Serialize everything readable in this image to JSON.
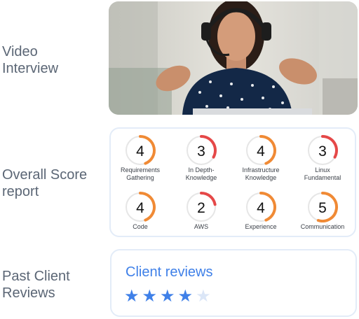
{
  "sections": {
    "video": {
      "line1": "Video",
      "line2": "Interview"
    },
    "score": {
      "line1": "Overall Score",
      "line2": "report"
    },
    "reviews": {
      "line1": "Past Client",
      "line2": "Reviews"
    }
  },
  "scores": [
    {
      "value": "4",
      "max": 5,
      "label1": "Requirements",
      "label2": "Gathering",
      "color": "#f08a35"
    },
    {
      "value": "3",
      "max": 5,
      "label1": "In Depth-",
      "label2": "Knowledge",
      "color": "#e54848"
    },
    {
      "value": "4",
      "max": 5,
      "label1": "Infrastructure",
      "label2": "Knowledge",
      "color": "#f08a35"
    },
    {
      "value": "3",
      "max": 5,
      "label1": "Linux",
      "label2": "Fundamental",
      "color": "#e54848"
    },
    {
      "value": "4",
      "max": 5,
      "label1": "Code",
      "label2": "",
      "color": "#f08a35"
    },
    {
      "value": "2",
      "max": 5,
      "label1": "AWS",
      "label2": "",
      "color": "#e54848"
    },
    {
      "value": "4",
      "max": 5,
      "label1": "Experience",
      "label2": "",
      "color": "#f08a35"
    },
    {
      "value": "5",
      "max": 5,
      "label1": "Communication",
      "label2": "",
      "color": "#f08a35"
    }
  ],
  "client_reviews": {
    "title": "Client reviews",
    "rating": 4,
    "max_rating": 5,
    "star_color": "#3f80e8",
    "empty_star_color": "#dbe6f7"
  }
}
